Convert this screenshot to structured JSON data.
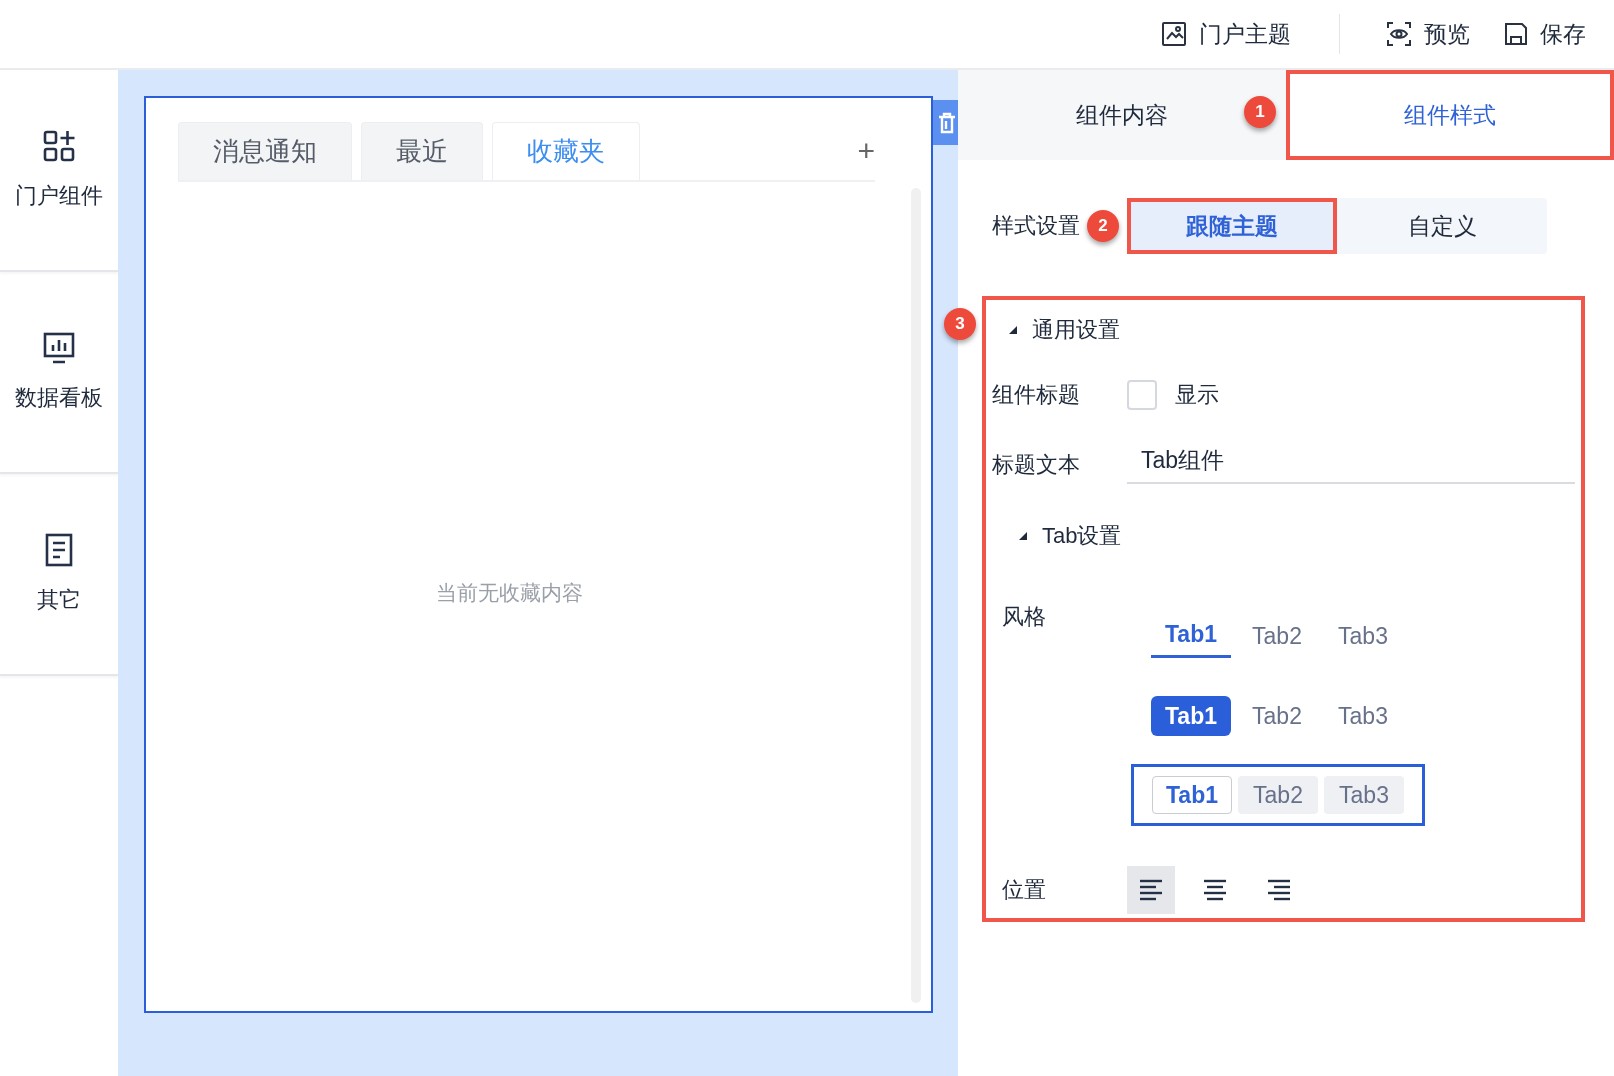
{
  "toolbar": [
    {
      "kind": "theme",
      "label": "门户主题"
    },
    {
      "kind": "preview",
      "label": "预览"
    },
    {
      "kind": "save",
      "label": "保存"
    }
  ],
  "sidebar": {
    "items": [
      {
        "kind": "components",
        "label": "门户组件"
      },
      {
        "kind": "dashboard",
        "label": "数据看板"
      },
      {
        "kind": "other",
        "label": "其它"
      }
    ]
  },
  "canvas": {
    "widget": {
      "tabs": [
        {
          "label": "消息通知",
          "selected": false
        },
        {
          "label": "最近",
          "selected": false
        },
        {
          "label": "收藏夹",
          "selected": true
        }
      ],
      "add_button": "+",
      "empty_text": "当前无收藏内容"
    }
  },
  "panel": {
    "tabs": [
      {
        "label": "组件内容",
        "selected": false
      },
      {
        "label": "组件样式",
        "selected": true,
        "annotation": "1"
      }
    ],
    "style_setting": {
      "label": "样式设置",
      "options": [
        {
          "label": "跟随主题",
          "selected": true,
          "annotation": "2"
        },
        {
          "label": "自定义",
          "selected": false
        }
      ]
    },
    "section": {
      "annotation": "3",
      "general": {
        "title": "通用设置",
        "expanded": true,
        "title_toggle": {
          "label": "组件标题",
          "checked": false,
          "text": "显示"
        },
        "title_text": {
          "label": "标题文本",
          "value": "Tab组件"
        }
      },
      "tab_settings": {
        "title": "Tab设置",
        "expanded": true,
        "style": {
          "label": "风格",
          "options": [
            {
              "kind": "underline",
              "selected": false,
              "tabs": [
                {
                  "label": "Tab1",
                  "selected": true
                },
                {
                  "label": "Tab2",
                  "selected": false
                },
                {
                  "label": "Tab3",
                  "selected": false
                }
              ]
            },
            {
              "kind": "pill",
              "selected": false,
              "tabs": [
                {
                  "label": "Tab1",
                  "selected": true
                },
                {
                  "label": "Tab2",
                  "selected": false
                },
                {
                  "label": "Tab3",
                  "selected": false
                }
              ]
            },
            {
              "kind": "card",
              "selected": true,
              "tabs": [
                {
                  "label": "Tab1",
                  "selected": true
                },
                {
                  "label": "Tab2",
                  "selected": false
                },
                {
                  "label": "Tab3",
                  "selected": false
                }
              ]
            }
          ]
        },
        "position": {
          "label": "位置",
          "options": [
            {
              "kind": "left",
              "selected": true
            },
            {
              "kind": "center",
              "selected": false
            },
            {
              "kind": "right",
              "selected": false
            }
          ]
        }
      }
    }
  }
}
